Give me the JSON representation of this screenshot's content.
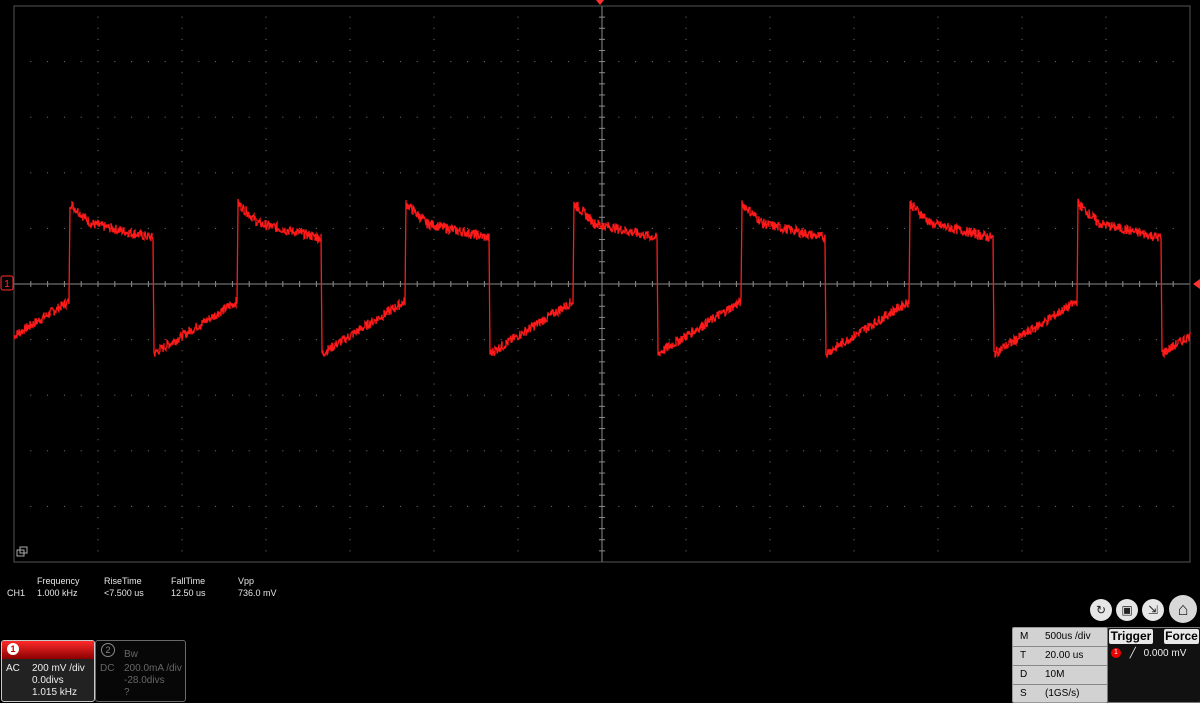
{
  "waveform": {
    "channel_marker": "1",
    "period_divisions": 2.0,
    "high_level_divs": 1.45,
    "low_level_divs": -1.25,
    "noise_divs": 0.18,
    "colors": {
      "trace": "#ff1a1a",
      "grid": "#7a7a7a",
      "background": "#000000"
    }
  },
  "measurements": {
    "channel": "CH1",
    "items": [
      {
        "label": "Frequency",
        "value": "1.000 kHz"
      },
      {
        "label": "RiseTime",
        "value": "<7.500 us"
      },
      {
        "label": "FallTime",
        "value": "12.50 us"
      },
      {
        "label": "Vpp",
        "value": "736.0 mV"
      }
    ]
  },
  "channel1": {
    "number": "1",
    "coupling": "AC",
    "scale": "200 mV /div",
    "offset": "0.0divs",
    "frequency": "1.015 kHz"
  },
  "channel2": {
    "number": "2",
    "bw": "Bw",
    "coupling": "DC",
    "scale": "200.0mA /div",
    "offset": "-28.0divs",
    "frequency": "?"
  },
  "toolbar": {
    "icons": [
      "refresh-icon",
      "save-icon",
      "export-icon",
      "home-icon"
    ]
  },
  "timebase": {
    "m_key": "M",
    "m_value": "500us /div",
    "t_key": "T",
    "t_value": "20.00 us",
    "d_key": "D",
    "d_value": "10M",
    "s_key": "S",
    "s_value": "(1GS/s)"
  },
  "trigger": {
    "trigger_label": "Trigger",
    "force_label": "Force",
    "channel": "1",
    "level": "0.000 mV"
  }
}
